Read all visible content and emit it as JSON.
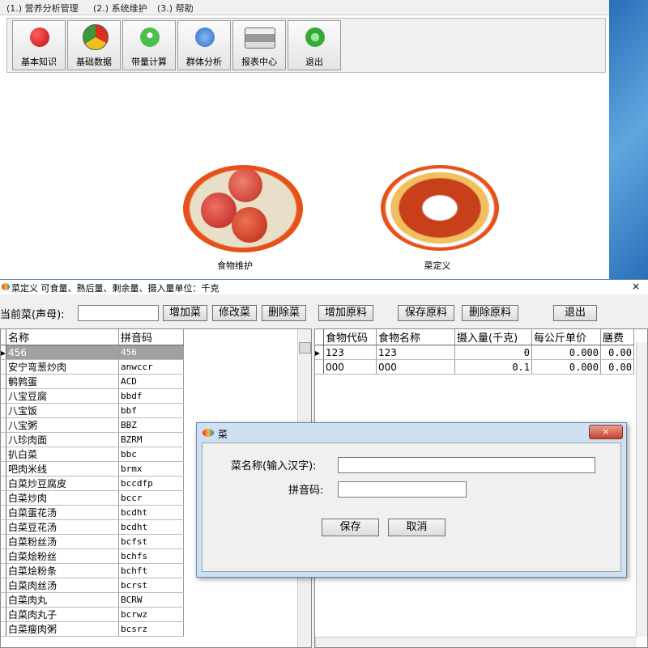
{
  "menu": [
    "(1.) 营养分析管理",
    "(2.) 系统维护",
    "(3.) 帮助"
  ],
  "toolbar": [
    {
      "label": "基本知识",
      "icon": "apple-icon",
      "color": "#d42020"
    },
    {
      "label": "基础数据",
      "icon": "pie-chart-icon",
      "color": "#3a8a3a"
    },
    {
      "label": "带量计算",
      "icon": "user-icon",
      "color": "#3aaa3a"
    },
    {
      "label": "群体分析",
      "icon": "document-icon",
      "color": "#2a70d0"
    },
    {
      "label": "报表中心",
      "icon": "printer-icon",
      "color": "#888888"
    },
    {
      "label": "退出",
      "icon": "refresh-icon",
      "color": "#3aaa3a"
    }
  ],
  "tiles": {
    "food": "食物维护",
    "dish": "菜定义"
  },
  "dish_window": {
    "title": "菜定义  可食量、熟后量、剩余量、摄入量单位：千克",
    "current_dish_label": "当前菜(声母):",
    "current_dish_value": "",
    "add_dish": "增加菜",
    "edit_dish": "修改菜",
    "delete_dish": "删除菜",
    "add_ingredient": "增加原料",
    "save_ingredient": "保存原料",
    "delete_ingredient": "删除原料",
    "exit": "退出",
    "close": "×"
  },
  "dish_grid": {
    "columns": [
      "名称",
      "拼音码"
    ],
    "rows": [
      [
        "456",
        "456"
      ],
      [
        "安宁弯葱炒肉",
        "anwccr"
      ],
      [
        "鹌鹑蛋",
        "ACD"
      ],
      [
        "八宝豆腐",
        "bbdf"
      ],
      [
        "八宝饭",
        "bbf"
      ],
      [
        "八宝粥",
        "BBZ"
      ],
      [
        "八珍肉面",
        "BZRM"
      ],
      [
        "扒白菜",
        "bbc"
      ],
      [
        "吧肉米线",
        "brmx"
      ],
      [
        "白菜炒豆腐皮",
        "bccdfp"
      ],
      [
        "白菜炒肉",
        "bccr"
      ],
      [
        "白菜蛋花汤",
        "bcdht"
      ],
      [
        "白菜豆花汤",
        "bcdht"
      ],
      [
        "白菜粉丝汤",
        "bcfst"
      ],
      [
        "白菜烩粉丝",
        "bchfs"
      ],
      [
        "白菜烩粉条",
        "bchft"
      ],
      [
        "白菜肉丝汤",
        "bcrst"
      ],
      [
        "白菜肉丸",
        "BCRW"
      ],
      [
        "白菜肉丸子",
        "bcrwz"
      ],
      [
        "白菜瘦肉粥",
        "bcsrz"
      ]
    ]
  },
  "ingredient_grid": {
    "columns": [
      "食物代码",
      "食物名称",
      "摄入量(千克)",
      "每公斤单价",
      "膳费"
    ],
    "rows": [
      [
        "123",
        "123",
        "0",
        "0.000",
        "0.00"
      ],
      [
        "000",
        "000",
        "0.1",
        "0.000",
        "0.00"
      ]
    ]
  },
  "dialog": {
    "title": "菜",
    "name_label": "菜名称(输入汉字):",
    "name_value": "",
    "pinyin_label": "拼音码:",
    "pinyin_value": "",
    "save": "保存",
    "cancel": "取消",
    "close": "×"
  }
}
